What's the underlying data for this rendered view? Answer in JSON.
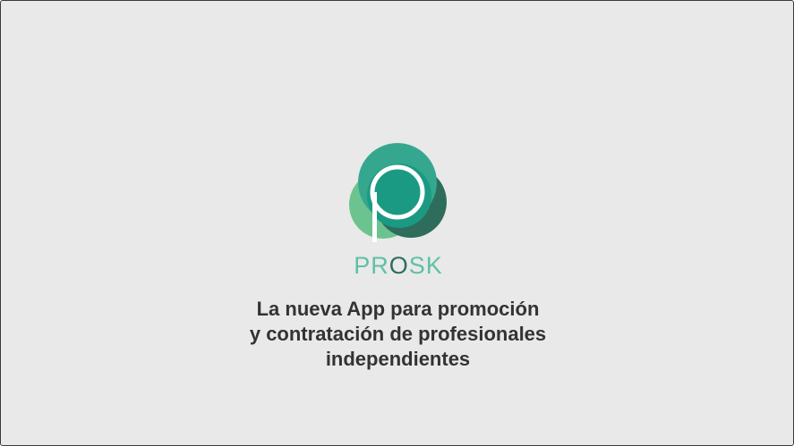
{
  "splash": {
    "logo_icon": "prosk-logo-icon",
    "brand": {
      "part1": "PR",
      "part2": "O",
      "part3": "SK"
    },
    "tagline": {
      "line1": "La nueva App para promoción",
      "line2": "y contratación de profesionales",
      "line3": "independientes"
    }
  },
  "colors": {
    "background": "#e9e9e9",
    "brand_light_green": "#5fc0a5",
    "brand_dark_green": "#2e6d5c",
    "teal": "#1b9a83",
    "text": "#333333"
  }
}
